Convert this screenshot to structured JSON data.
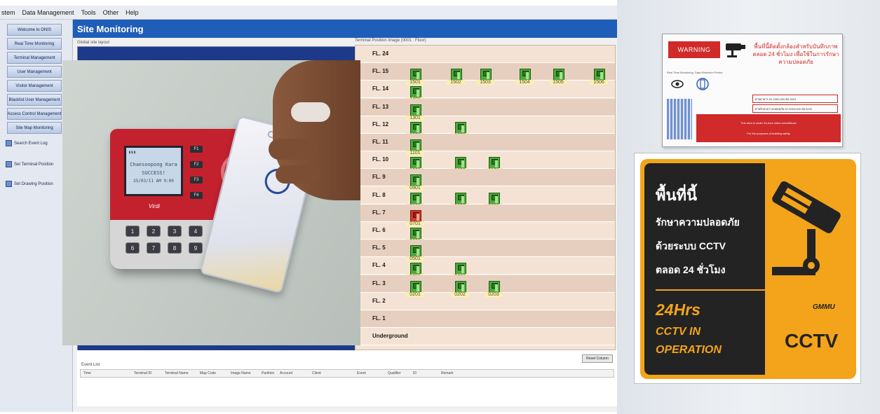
{
  "menu": [
    "stem",
    "Data Management",
    "Tools",
    "Other",
    "Help"
  ],
  "sidebar": {
    "items": [
      "Welcome to ONIS",
      "Real Time Monitoring",
      "Terminal Management",
      "User Management",
      "Visitor Management",
      "Blacklist User Management",
      "Access Control Management",
      "Site Map Monitoring"
    ],
    "tools": [
      "Search Event Log",
      "Set Terminal Position",
      "Set Drawing Position"
    ]
  },
  "main": {
    "title": "Site Monitoring",
    "global_label": "Global site layout",
    "terminal_label": "Terminal Position Image (0001 : Floor)"
  },
  "floors": [
    {
      "label": "FL. 24",
      "rooms": []
    },
    {
      "label": "FL. 15",
      "rooms": [
        "1501",
        "1502",
        "1503",
        "1504",
        "1505",
        "1506"
      ]
    },
    {
      "label": "FL. 14",
      "rooms": [
        "1401"
      ]
    },
    {
      "label": "FL. 13",
      "rooms": [
        "1301"
      ]
    },
    {
      "label": "FL. 12",
      "rooms": [
        "1201",
        "1202"
      ]
    },
    {
      "label": "FL. 11",
      "rooms": [
        "1101"
      ]
    },
    {
      "label": "FL. 10",
      "rooms": [
        "1001",
        "1002",
        "0101"
      ]
    },
    {
      "label": "FL. 9",
      "rooms": [
        "0901"
      ]
    },
    {
      "label": "FL. 8",
      "rooms": [
        "0801",
        "0802",
        "0803"
      ]
    },
    {
      "label": "FL. 7",
      "rooms": [
        "0701"
      ]
    },
    {
      "label": "FL. 6",
      "rooms": [
        "0601"
      ]
    },
    {
      "label": "FL. 5",
      "rooms": [
        "0501"
      ]
    },
    {
      "label": "FL. 4",
      "rooms": [
        "0401",
        "0402"
      ]
    },
    {
      "label": "FL. 3",
      "rooms": [
        "0201",
        "0202",
        "0203"
      ]
    },
    {
      "label": "FL. 2",
      "rooms": []
    },
    {
      "label": "FL. 1",
      "rooms": []
    },
    {
      "label": "Underground",
      "rooms": []
    }
  ],
  "event": {
    "reset_button": "Reset Column",
    "list_label": "Event List",
    "columns": [
      "Time",
      "Terminal ID",
      "Terminal Name",
      "Map Code",
      "Image Name",
      "Partition",
      "Account",
      "Client",
      "Event",
      "Qualifier",
      "ID",
      "Remark"
    ]
  },
  "photo": {
    "screen_name": "Chaesoopong Kara",
    "screen_status": "SUCCESS!",
    "screen_time": "25/03/11 AM 9:09",
    "device_brand": "Virdi",
    "fkeys": [
      "F1",
      "F2",
      "F3",
      "F4"
    ],
    "keypad": [
      "1",
      "2",
      "3",
      "4",
      "6",
      "7",
      "8",
      "9"
    ]
  },
  "warn_sign": {
    "badge": "WARNING",
    "thai_heading": "พื้นที่นี้ติดตั้งกล้องสำหรับบันทึกภาพ ตลอด 24 ชั่วโมง เพื่อใช้ในการรักษาความปลอดภัย",
    "icon_labels": [
      "Real Time Monitoring",
      "Data Retention Period"
    ],
    "contact_1": "ฝ่ายอาคาร 02-2063-000 ต่อ 5201",
    "contact_2": "ฝ่ายรักษาความปลอดภัย 02-2063-000 ต่อ 5202",
    "banner_1": "This area is under 24-hour video surveillance",
    "banner_2": "For the purposes of building safety"
  },
  "cctv_sign": {
    "title": "พื้นที่นี้",
    "lines": [
      "รักษาความปลอดภัย",
      "ด้วยระบบ CCTV",
      "ตลอด 24 ชั่วโมง"
    ],
    "hours": "24Hrs",
    "en_1": "CCTV IN",
    "en_2": "OPERATION",
    "brand": "GMMU",
    "word": "CCTV"
  },
  "colors": {
    "title_bar": "#1e5db8",
    "room_ok": "#4caa3c",
    "room_alarm": "#d33a2b",
    "cctv_orange": "#f3a41b",
    "warning_red": "#d02a2a"
  }
}
